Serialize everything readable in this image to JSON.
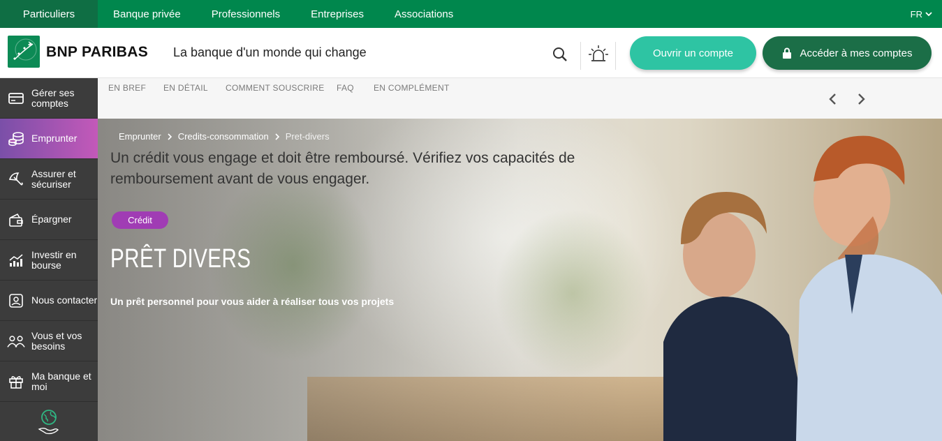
{
  "topbar": {
    "items": [
      "Particuliers",
      "Banque privée",
      "Professionnels",
      "Entreprises",
      "Associations"
    ],
    "language": "FR"
  },
  "header": {
    "brand": "BNP PARIBAS",
    "tagline": "La banque d'un monde qui change",
    "open_account": "Ouvrir un compte",
    "access_accounts": "Accéder à mes comptes"
  },
  "sidebar": {
    "items": [
      {
        "label": "Gérer ses comptes",
        "icon": "card-icon"
      },
      {
        "label": "Emprunter",
        "icon": "coins-icon"
      },
      {
        "label": "Assurer et sécuriser",
        "icon": "umbrella-icon"
      },
      {
        "label": "Épargner",
        "icon": "wallet-icon"
      },
      {
        "label": "Investir en bourse",
        "icon": "chart-icon"
      },
      {
        "label": "Nous contacter",
        "icon": "contact-icon"
      },
      {
        "label": "Vous et vos besoins",
        "icon": "people-icon"
      },
      {
        "label": "Ma banque et moi",
        "icon": "gift-icon"
      }
    ]
  },
  "subnav": {
    "tabs": [
      "EN BREF",
      "EN DÉTAIL",
      "COMMENT SOUSCRIRE",
      "FAQ",
      "EN COMPLÉMENT"
    ]
  },
  "hero": {
    "breadcrumb": [
      "Emprunter",
      "Credits-consommation",
      "Pret-divers"
    ],
    "notice": "Un crédit vous engage et doit être remboursé. Vérifiez vos capacités de remboursement avant de vous engager.",
    "badge": "Crédit",
    "title": "PRÊT DIVERS",
    "subtitle": "Un prêt personnel pour vous aider à réaliser tous vos projets"
  },
  "colors": {
    "brand_green": "#00874d",
    "active_tab": "#0f6e44",
    "open_button": "#2ec4a3",
    "access_button": "#1b6e47",
    "badge": "#a03cb4"
  }
}
